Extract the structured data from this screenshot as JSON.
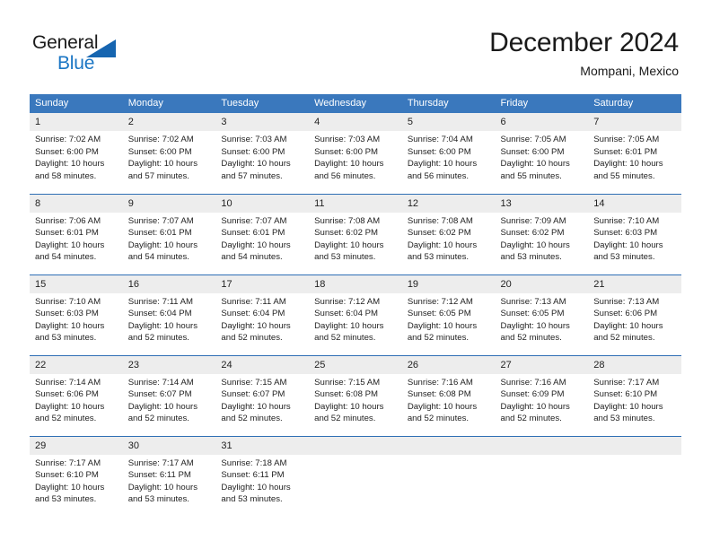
{
  "brand": {
    "name_part1": "General",
    "name_part2": "Blue",
    "accent_color": "#1b76c4",
    "triangle_color": "#1665b0"
  },
  "header": {
    "title": "December 2024",
    "subtitle": "Mompani, Mexico"
  },
  "calendar": {
    "header_bg": "#3a78bd",
    "daynum_bg": "#ededed",
    "row_divider_color": "#2f6fb5",
    "weekday_headers": [
      "Sunday",
      "Monday",
      "Tuesday",
      "Wednesday",
      "Thursday",
      "Friday",
      "Saturday"
    ],
    "weeks": [
      [
        {
          "day": "1",
          "sunrise": "Sunrise: 7:02 AM",
          "sunset": "Sunset: 6:00 PM",
          "daylight_line1": "Daylight: 10 hours",
          "daylight_line2": "and 58 minutes."
        },
        {
          "day": "2",
          "sunrise": "Sunrise: 7:02 AM",
          "sunset": "Sunset: 6:00 PM",
          "daylight_line1": "Daylight: 10 hours",
          "daylight_line2": "and 57 minutes."
        },
        {
          "day": "3",
          "sunrise": "Sunrise: 7:03 AM",
          "sunset": "Sunset: 6:00 PM",
          "daylight_line1": "Daylight: 10 hours",
          "daylight_line2": "and 57 minutes."
        },
        {
          "day": "4",
          "sunrise": "Sunrise: 7:03 AM",
          "sunset": "Sunset: 6:00 PM",
          "daylight_line1": "Daylight: 10 hours",
          "daylight_line2": "and 56 minutes."
        },
        {
          "day": "5",
          "sunrise": "Sunrise: 7:04 AM",
          "sunset": "Sunset: 6:00 PM",
          "daylight_line1": "Daylight: 10 hours",
          "daylight_line2": "and 56 minutes."
        },
        {
          "day": "6",
          "sunrise": "Sunrise: 7:05 AM",
          "sunset": "Sunset: 6:00 PM",
          "daylight_line1": "Daylight: 10 hours",
          "daylight_line2": "and 55 minutes."
        },
        {
          "day": "7",
          "sunrise": "Sunrise: 7:05 AM",
          "sunset": "Sunset: 6:01 PM",
          "daylight_line1": "Daylight: 10 hours",
          "daylight_line2": "and 55 minutes."
        }
      ],
      [
        {
          "day": "8",
          "sunrise": "Sunrise: 7:06 AM",
          "sunset": "Sunset: 6:01 PM",
          "daylight_line1": "Daylight: 10 hours",
          "daylight_line2": "and 54 minutes."
        },
        {
          "day": "9",
          "sunrise": "Sunrise: 7:07 AM",
          "sunset": "Sunset: 6:01 PM",
          "daylight_line1": "Daylight: 10 hours",
          "daylight_line2": "and 54 minutes."
        },
        {
          "day": "10",
          "sunrise": "Sunrise: 7:07 AM",
          "sunset": "Sunset: 6:01 PM",
          "daylight_line1": "Daylight: 10 hours",
          "daylight_line2": "and 54 minutes."
        },
        {
          "day": "11",
          "sunrise": "Sunrise: 7:08 AM",
          "sunset": "Sunset: 6:02 PM",
          "daylight_line1": "Daylight: 10 hours",
          "daylight_line2": "and 53 minutes."
        },
        {
          "day": "12",
          "sunrise": "Sunrise: 7:08 AM",
          "sunset": "Sunset: 6:02 PM",
          "daylight_line1": "Daylight: 10 hours",
          "daylight_line2": "and 53 minutes."
        },
        {
          "day": "13",
          "sunrise": "Sunrise: 7:09 AM",
          "sunset": "Sunset: 6:02 PM",
          "daylight_line1": "Daylight: 10 hours",
          "daylight_line2": "and 53 minutes."
        },
        {
          "day": "14",
          "sunrise": "Sunrise: 7:10 AM",
          "sunset": "Sunset: 6:03 PM",
          "daylight_line1": "Daylight: 10 hours",
          "daylight_line2": "and 53 minutes."
        }
      ],
      [
        {
          "day": "15",
          "sunrise": "Sunrise: 7:10 AM",
          "sunset": "Sunset: 6:03 PM",
          "daylight_line1": "Daylight: 10 hours",
          "daylight_line2": "and 53 minutes."
        },
        {
          "day": "16",
          "sunrise": "Sunrise: 7:11 AM",
          "sunset": "Sunset: 6:04 PM",
          "daylight_line1": "Daylight: 10 hours",
          "daylight_line2": "and 52 minutes."
        },
        {
          "day": "17",
          "sunrise": "Sunrise: 7:11 AM",
          "sunset": "Sunset: 6:04 PM",
          "daylight_line1": "Daylight: 10 hours",
          "daylight_line2": "and 52 minutes."
        },
        {
          "day": "18",
          "sunrise": "Sunrise: 7:12 AM",
          "sunset": "Sunset: 6:04 PM",
          "daylight_line1": "Daylight: 10 hours",
          "daylight_line2": "and 52 minutes."
        },
        {
          "day": "19",
          "sunrise": "Sunrise: 7:12 AM",
          "sunset": "Sunset: 6:05 PM",
          "daylight_line1": "Daylight: 10 hours",
          "daylight_line2": "and 52 minutes."
        },
        {
          "day": "20",
          "sunrise": "Sunrise: 7:13 AM",
          "sunset": "Sunset: 6:05 PM",
          "daylight_line1": "Daylight: 10 hours",
          "daylight_line2": "and 52 minutes."
        },
        {
          "day": "21",
          "sunrise": "Sunrise: 7:13 AM",
          "sunset": "Sunset: 6:06 PM",
          "daylight_line1": "Daylight: 10 hours",
          "daylight_line2": "and 52 minutes."
        }
      ],
      [
        {
          "day": "22",
          "sunrise": "Sunrise: 7:14 AM",
          "sunset": "Sunset: 6:06 PM",
          "daylight_line1": "Daylight: 10 hours",
          "daylight_line2": "and 52 minutes."
        },
        {
          "day": "23",
          "sunrise": "Sunrise: 7:14 AM",
          "sunset": "Sunset: 6:07 PM",
          "daylight_line1": "Daylight: 10 hours",
          "daylight_line2": "and 52 minutes."
        },
        {
          "day": "24",
          "sunrise": "Sunrise: 7:15 AM",
          "sunset": "Sunset: 6:07 PM",
          "daylight_line1": "Daylight: 10 hours",
          "daylight_line2": "and 52 minutes."
        },
        {
          "day": "25",
          "sunrise": "Sunrise: 7:15 AM",
          "sunset": "Sunset: 6:08 PM",
          "daylight_line1": "Daylight: 10 hours",
          "daylight_line2": "and 52 minutes."
        },
        {
          "day": "26",
          "sunrise": "Sunrise: 7:16 AM",
          "sunset": "Sunset: 6:08 PM",
          "daylight_line1": "Daylight: 10 hours",
          "daylight_line2": "and 52 minutes."
        },
        {
          "day": "27",
          "sunrise": "Sunrise: 7:16 AM",
          "sunset": "Sunset: 6:09 PM",
          "daylight_line1": "Daylight: 10 hours",
          "daylight_line2": "and 52 minutes."
        },
        {
          "day": "28",
          "sunrise": "Sunrise: 7:17 AM",
          "sunset": "Sunset: 6:10 PM",
          "daylight_line1": "Daylight: 10 hours",
          "daylight_line2": "and 53 minutes."
        }
      ],
      [
        {
          "day": "29",
          "sunrise": "Sunrise: 7:17 AM",
          "sunset": "Sunset: 6:10 PM",
          "daylight_line1": "Daylight: 10 hours",
          "daylight_line2": "and 53 minutes."
        },
        {
          "day": "30",
          "sunrise": "Sunrise: 7:17 AM",
          "sunset": "Sunset: 6:11 PM",
          "daylight_line1": "Daylight: 10 hours",
          "daylight_line2": "and 53 minutes."
        },
        {
          "day": "31",
          "sunrise": "Sunrise: 7:18 AM",
          "sunset": "Sunset: 6:11 PM",
          "daylight_line1": "Daylight: 10 hours",
          "daylight_line2": "and 53 minutes."
        },
        {
          "day": "",
          "sunrise": "",
          "sunset": "",
          "daylight_line1": "",
          "daylight_line2": ""
        },
        {
          "day": "",
          "sunrise": "",
          "sunset": "",
          "daylight_line1": "",
          "daylight_line2": ""
        },
        {
          "day": "",
          "sunrise": "",
          "sunset": "",
          "daylight_line1": "",
          "daylight_line2": ""
        },
        {
          "day": "",
          "sunrise": "",
          "sunset": "",
          "daylight_line1": "",
          "daylight_line2": ""
        }
      ]
    ]
  }
}
